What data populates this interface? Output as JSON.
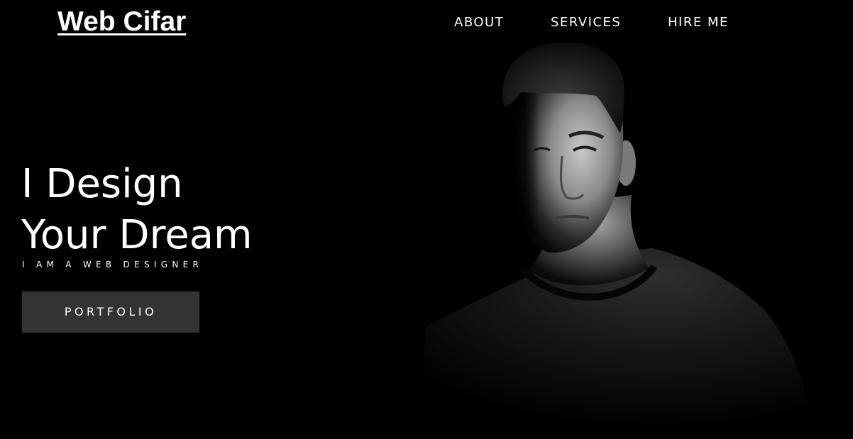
{
  "header": {
    "logo": "Web Cifar",
    "nav": [
      {
        "label": "ABOUT"
      },
      {
        "label": "SERVICES"
      },
      {
        "label": "HIRE ME"
      }
    ]
  },
  "hero": {
    "title_line1": "I Design",
    "title_line2": "Your Dream",
    "subtitle": "I AM A WEB DESIGNER",
    "button_label": "PORTFOLIO"
  },
  "colors": {
    "background": "#000000",
    "text": "#ffffff",
    "button_bg": "#333333"
  },
  "icons": {
    "portrait": "man-portrait-photo"
  }
}
